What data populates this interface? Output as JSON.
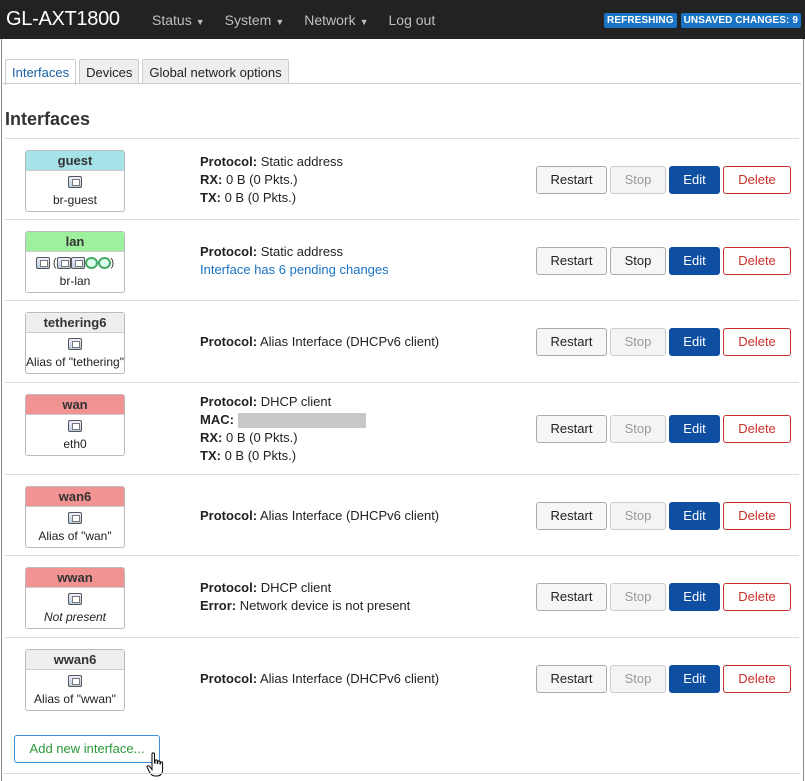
{
  "header": {
    "brand": "GL-AXT1800",
    "menu": [
      {
        "label": "Status",
        "caret": true
      },
      {
        "label": "System",
        "caret": true
      },
      {
        "label": "Network",
        "caret": true
      },
      {
        "label": "Log out",
        "caret": false
      }
    ],
    "indicators": {
      "refreshing": "REFRESHING",
      "unsaved": "UNSAVED CHANGES: 9"
    },
    "accent_color": "#1a73c4"
  },
  "tabs": [
    {
      "label": "Interfaces",
      "active": true
    },
    {
      "label": "Devices",
      "active": false
    },
    {
      "label": "Global network options",
      "active": false
    }
  ],
  "section_title": "Interfaces",
  "interfaces": [
    {
      "name": "guest",
      "color": "#a6e3e9",
      "device": "br-guest",
      "icons": [
        "device-icon"
      ],
      "lines": [
        {
          "label": "Protocol:",
          "value": "Static address"
        },
        {
          "label": "RX:",
          "value": "0 B (0 Pkts.)"
        },
        {
          "label": "TX:",
          "value": "0 B (0 Pkts.)"
        }
      ],
      "stop_disabled": true
    },
    {
      "name": "lan",
      "color": "#9ef09e",
      "device": "br-lan",
      "icons": [
        "bridge-icon",
        "port-icons",
        "wifi-icons"
      ],
      "lines": [
        {
          "label": "Protocol:",
          "value": "Static address"
        }
      ],
      "pending": "Interface has 6 pending changes",
      "stop_disabled": false
    },
    {
      "name": "tethering6",
      "color": "#eeeeee",
      "device": "Alias of \"tethering\"",
      "icons": [
        "device-icon"
      ],
      "lines": [
        {
          "label": "Protocol:",
          "value": "Alias Interface (DHCPv6 client)"
        }
      ],
      "stop_disabled": true
    },
    {
      "name": "wan",
      "color": "#f29393",
      "device": "eth0",
      "icons": [
        "device-icon"
      ],
      "lines": [
        {
          "label": "Protocol:",
          "value": "DHCP client"
        },
        {
          "label": "MAC:",
          "value": "",
          "redacted": true
        },
        {
          "label": "RX:",
          "value": "0 B (0 Pkts.)"
        },
        {
          "label": "TX:",
          "value": "0 B (0 Pkts.)"
        }
      ],
      "stop_disabled": true
    },
    {
      "name": "wan6",
      "color": "#f29393",
      "device": "Alias of \"wan\"",
      "icons": [
        "device-icon"
      ],
      "lines": [
        {
          "label": "Protocol:",
          "value": "Alias Interface (DHCPv6 client)"
        }
      ],
      "stop_disabled": true
    },
    {
      "name": "wwan",
      "color": "#f29393",
      "device": "Not present",
      "device_italic": true,
      "icons": [
        "device-icon"
      ],
      "lines": [
        {
          "label": "Protocol:",
          "value": "DHCP client"
        },
        {
          "label": "Error:",
          "value": "Network device is not present"
        }
      ],
      "stop_disabled": true
    },
    {
      "name": "wwan6",
      "color": "#eeeeee",
      "device": "Alias of \"wwan\"",
      "icons": [
        "device-icon"
      ],
      "lines": [
        {
          "label": "Protocol:",
          "value": "Alias Interface (DHCPv6 client)"
        }
      ],
      "stop_disabled": true
    }
  ],
  "buttons": {
    "restart": "Restart",
    "stop": "Stop",
    "edit": "Edit",
    "delete": "Delete"
  },
  "add_button": "Add new interface..."
}
